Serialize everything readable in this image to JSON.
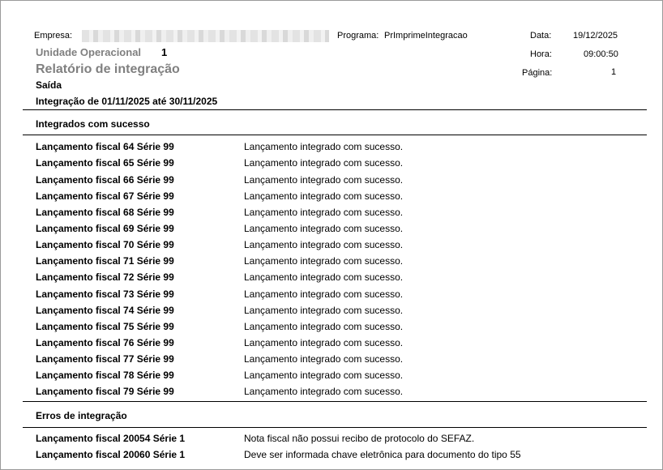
{
  "header": {
    "empresa_label": "Empresa:",
    "programa_label": "Programa:",
    "programa_value": "PrImprimeIntegracao",
    "data_label": "Data:",
    "data_value": "19/12/2025",
    "hora_label": "Hora:",
    "hora_value": "09:00:50",
    "pagina_label": "Página:",
    "pagina_value": "1",
    "unidade_label": "Unidade Operacional",
    "unidade_value": "1",
    "report_title": "Relatório de integração",
    "tipo": "Saída",
    "periodo": "Integração de 01/11/2025 até 30/11/2025"
  },
  "success_section": {
    "title": "Integrados com sucesso",
    "rows": [
      {
        "label": "Lançamento fiscal 64 Série 99",
        "message": "Lançamento integrado com sucesso."
      },
      {
        "label": "Lançamento fiscal 65 Série 99",
        "message": "Lançamento integrado com sucesso."
      },
      {
        "label": "Lançamento fiscal 66 Série 99",
        "message": "Lançamento integrado com sucesso."
      },
      {
        "label": "Lançamento fiscal 67 Série 99",
        "message": "Lançamento integrado com sucesso."
      },
      {
        "label": "Lançamento fiscal 68 Série 99",
        "message": "Lançamento integrado com sucesso."
      },
      {
        "label": "Lançamento fiscal 69 Série 99",
        "message": "Lançamento integrado com sucesso."
      },
      {
        "label": "Lançamento fiscal 70 Série 99",
        "message": "Lançamento integrado com sucesso."
      },
      {
        "label": "Lançamento fiscal 71 Série 99",
        "message": "Lançamento integrado com sucesso."
      },
      {
        "label": "Lançamento fiscal 72 Série 99",
        "message": "Lançamento integrado com sucesso."
      },
      {
        "label": "Lançamento fiscal 73 Série 99",
        "message": "Lançamento integrado com sucesso."
      },
      {
        "label": "Lançamento fiscal 74 Série 99",
        "message": "Lançamento integrado com sucesso."
      },
      {
        "label": "Lançamento fiscal 75 Série 99",
        "message": "Lançamento integrado com sucesso."
      },
      {
        "label": "Lançamento fiscal 76 Série 99",
        "message": "Lançamento integrado com sucesso."
      },
      {
        "label": "Lançamento fiscal 77 Série 99",
        "message": "Lançamento integrado com sucesso."
      },
      {
        "label": "Lançamento fiscal 78 Série 99",
        "message": "Lançamento integrado com sucesso."
      },
      {
        "label": "Lançamento fiscal 79 Série 99",
        "message": "Lançamento integrado com sucesso."
      }
    ]
  },
  "error_section": {
    "title": "Erros de integração",
    "rows": [
      {
        "label": "Lançamento fiscal 20054 Série 1",
        "message": "Nota fiscal não possui recibo de protocolo do SEFAZ."
      },
      {
        "label": "Lançamento fiscal 20060 Série 1",
        "message": "Deve ser informada chave eletrônica para documento do tipo 55"
      }
    ]
  }
}
